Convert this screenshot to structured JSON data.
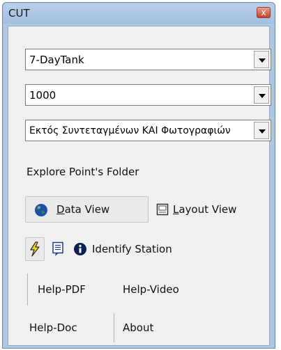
{
  "window": {
    "title": "CUT",
    "close_glyph": "x"
  },
  "combos": {
    "layer": {
      "value": "7-DayTank"
    },
    "count": {
      "value": "1000"
    },
    "filter": {
      "value": "Εκτός Συντεταγμένων ΚΑΙ Φωτογραφιών"
    }
  },
  "explore": {
    "label": "Explore Point's Folder"
  },
  "views": {
    "data_view": {
      "label": "Data View",
      "icon": "globe-icon",
      "active": true
    },
    "layout_view": {
      "label": "Layout View",
      "icon": "layout-page-icon",
      "active": false
    }
  },
  "tools": {
    "flash": {
      "icon": "lightning-icon",
      "active": true
    },
    "notes": {
      "icon": "notepad-icon"
    },
    "identify": {
      "label": "Identify Station",
      "icon": "info-icon"
    }
  },
  "help": {
    "pdf": {
      "label": "Help-PDF"
    },
    "video": {
      "label": "Help-Video"
    },
    "doc": {
      "label": "Help-Doc"
    },
    "about": {
      "label": "About"
    }
  },
  "colors": {
    "title_bar": "#afc7e2",
    "panel_bg": "#f0f0f0",
    "close_button": "#c7402c",
    "globe_blue": "#1f4fa8",
    "flash_yellow": "#f3d11a"
  }
}
